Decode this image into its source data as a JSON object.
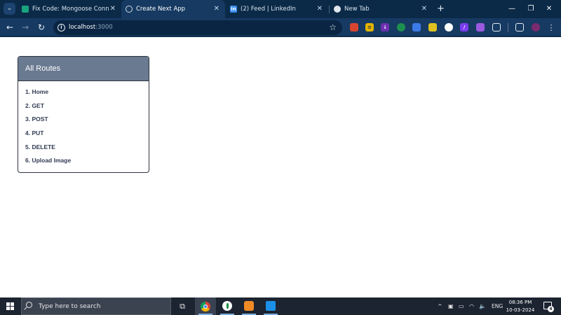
{
  "browser": {
    "tabs": [
      {
        "title": "Fix Code: Mongoose Connectio",
        "icon": "chatgpt-icon",
        "active": false
      },
      {
        "title": "Create Next App",
        "icon": "globe-icon",
        "active": true
      },
      {
        "title": "(2) Feed | LinkedIn",
        "icon": "linkedin-icon",
        "active": false
      },
      {
        "title": "New Tab",
        "icon": "chrome-icon",
        "active": false
      }
    ],
    "address": {
      "host": "localhost",
      "port": ":3000"
    }
  },
  "page": {
    "card_title": "All Routes",
    "routes": [
      "1. Home",
      "2. GET",
      "3. POST",
      "4. PUT",
      "5. DELETE",
      "6. Upload Image"
    ]
  },
  "taskbar": {
    "search_placeholder": "Type here to search",
    "language": "ENG",
    "time": "08:36 PM",
    "date": "10-03-2024",
    "notification_count": "4"
  },
  "colors": {
    "tabbar_bg": "#0b2a48",
    "toolbar_bg": "#163a62",
    "card_header": "#697a91",
    "route_text": "#2f3a52",
    "taskbar_bg": "#1c2331"
  }
}
